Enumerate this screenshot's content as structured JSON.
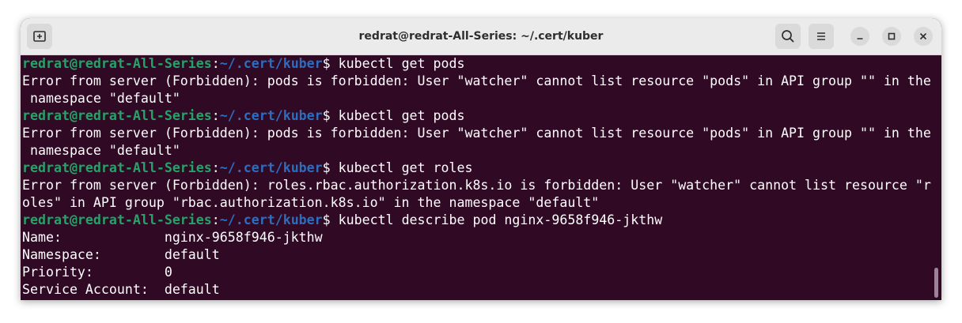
{
  "window": {
    "title": "redrat@redrat-All-Series: ~/.cert/kuber"
  },
  "icons": {
    "new_tab": "new-tab-icon",
    "search": "search-icon",
    "menu": "hamburger-menu-icon",
    "minimize": "minimize-icon",
    "maximize": "maximize-icon",
    "close": "close-icon"
  },
  "colors": {
    "terminal_bg": "#300a24",
    "prompt_user": "#26a269",
    "prompt_path": "#2d6dc0",
    "text": "#ffffff"
  },
  "terminal": {
    "prompt": {
      "user": "redrat@redrat-All-Series",
      "separator": ":",
      "path": "~/.cert/kuber",
      "symbol": "$ "
    },
    "lines": [
      {
        "type": "cmd",
        "text": "kubectl get pods"
      },
      {
        "type": "out",
        "text": "Error from server (Forbidden): pods is forbidden: User \"watcher\" cannot list resource \"pods\" in API group \"\" in the"
      },
      {
        "type": "out",
        "text": " namespace \"default\""
      },
      {
        "type": "cmd",
        "text": "kubectl get pods"
      },
      {
        "type": "out",
        "text": "Error from server (Forbidden): pods is forbidden: User \"watcher\" cannot list resource \"pods\" in API group \"\" in the"
      },
      {
        "type": "out",
        "text": " namespace \"default\""
      },
      {
        "type": "cmd",
        "text": "kubectl get roles"
      },
      {
        "type": "out",
        "text": "Error from server (Forbidden): roles.rbac.authorization.k8s.io is forbidden: User \"watcher\" cannot list resource \"r"
      },
      {
        "type": "out",
        "text": "oles\" in API group \"rbac.authorization.k8s.io\" in the namespace \"default\""
      },
      {
        "type": "cmd",
        "text": "kubectl describe pod nginx-9658f946-jkthw"
      },
      {
        "type": "out",
        "text": "Name:             nginx-9658f946-jkthw"
      },
      {
        "type": "out",
        "text": "Namespace:        default"
      },
      {
        "type": "out",
        "text": "Priority:         0"
      },
      {
        "type": "out",
        "text": "Service Account:  default"
      }
    ]
  }
}
